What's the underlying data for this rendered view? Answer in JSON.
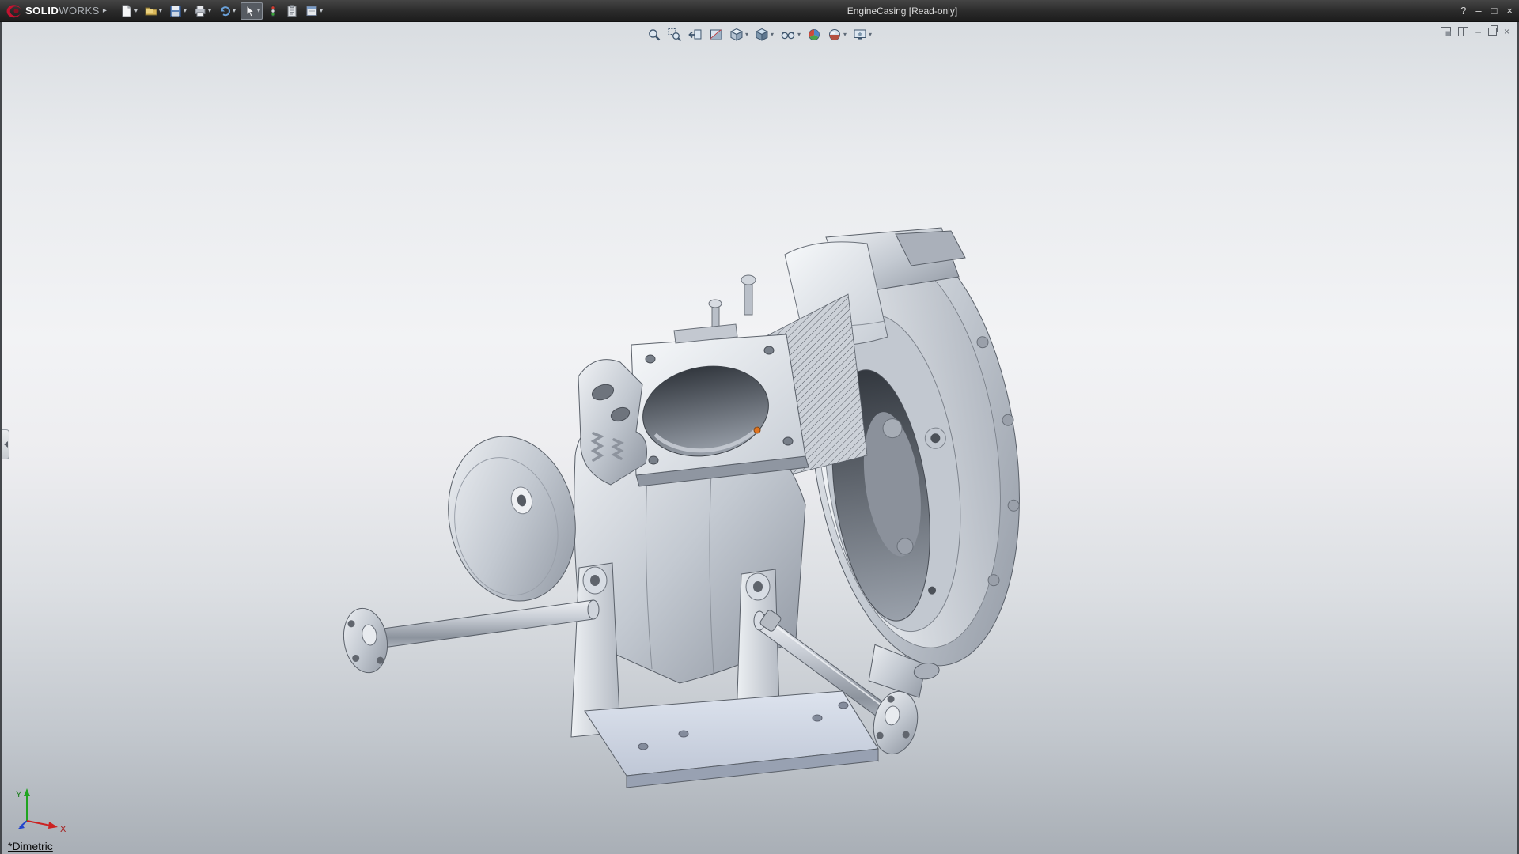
{
  "titlebar": {
    "brand": {
      "logo": "solidworks-3ds-logo",
      "text_bold": "SOLID",
      "text_light": "WORKS"
    },
    "menu_expand_glyph": "▸",
    "document_title": "EngineCasing [Read-only]",
    "quick_tools": [
      {
        "name": "new",
        "icon": "new-document-icon",
        "dropdown": true
      },
      {
        "name": "open",
        "icon": "open-folder-icon",
        "dropdown": true
      },
      {
        "name": "save",
        "icon": "save-icon",
        "dropdown": true
      },
      {
        "name": "print",
        "icon": "print-icon",
        "dropdown": true
      },
      {
        "name": "undo",
        "icon": "undo-icon",
        "dropdown": true
      },
      {
        "name": "select",
        "icon": "select-arrow-icon",
        "dropdown": true,
        "pressed": true
      },
      {
        "name": "xpress-products",
        "icon": "xpress-products-icon",
        "dropdown": false
      },
      {
        "name": "file-properties",
        "icon": "file-properties-icon",
        "dropdown": false
      },
      {
        "name": "options",
        "icon": "options-icon",
        "dropdown": true
      }
    ],
    "window_controls": {
      "help_glyph": "?",
      "minimize_glyph": "–",
      "maximize_glyph": "□",
      "close_glyph": "×"
    }
  },
  "heads_up_toolbar": {
    "dropdown_glyph": "▾",
    "tools": [
      {
        "name": "zoom-to-fit",
        "dropdown": false
      },
      {
        "name": "zoom-to-area",
        "dropdown": false
      },
      {
        "name": "previous-view",
        "dropdown": false
      },
      {
        "name": "section-view",
        "dropdown": false
      },
      {
        "name": "view-orientation",
        "dropdown": true
      },
      {
        "name": "display-style",
        "dropdown": true
      },
      {
        "name": "hide-show-items",
        "dropdown": true
      },
      {
        "name": "edit-appearance",
        "dropdown": false
      },
      {
        "name": "apply-scene",
        "dropdown": true
      },
      {
        "name": "view-settings",
        "dropdown": true
      }
    ]
  },
  "doc_window_controls": {
    "items": [
      "select-pane",
      "split-panes",
      "minimize-document",
      "restore-document",
      "close-document"
    ],
    "minimize_glyph": "–",
    "close_glyph": "×"
  },
  "viewport": {
    "view_label": "*Dimetric",
    "model_name": "EngineCasing"
  },
  "triad": {
    "x_label": "X",
    "y_label": "Y"
  },
  "colors": {
    "titlebar": "#2a2a2a",
    "background_top": "#d9dde1",
    "background_bottom": "#a9afb6",
    "model_metal": "#c6ccd4",
    "selection_marker": "#e0731f",
    "triad_x": "#cc2222",
    "triad_y": "#1fa41f",
    "triad_z": "#2244cc",
    "logo_red": "#c41230"
  }
}
